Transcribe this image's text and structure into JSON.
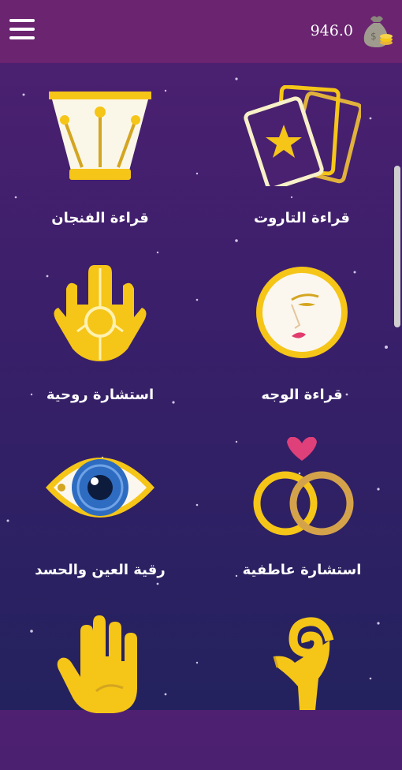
{
  "header": {
    "balance": "946.0",
    "menu_icon": "hamburger-menu-icon",
    "wallet_icon": "money-bag-icon"
  },
  "colors": {
    "header_bg": "#6a2470",
    "gold": "#f5c518",
    "text": "#ffffff"
  },
  "services": [
    {
      "label": "قراءة التاروت",
      "icon": "tarot-cards-icon"
    },
    {
      "label": "قراءة الفنجان",
      "icon": "coffee-cup-icon"
    },
    {
      "label": "قراءة الوجه",
      "icon": "face-icon"
    },
    {
      "label": "استشارة روحية",
      "icon": "hamsa-hand-icon"
    },
    {
      "label": "استشارة عاطفية",
      "icon": "rings-heart-icon"
    },
    {
      "label": "رقية العين والحسد",
      "icon": "evil-eye-icon"
    },
    {
      "label": "",
      "icon": "aries-ram-icon"
    },
    {
      "label": "",
      "icon": "palm-hand-icon"
    }
  ]
}
